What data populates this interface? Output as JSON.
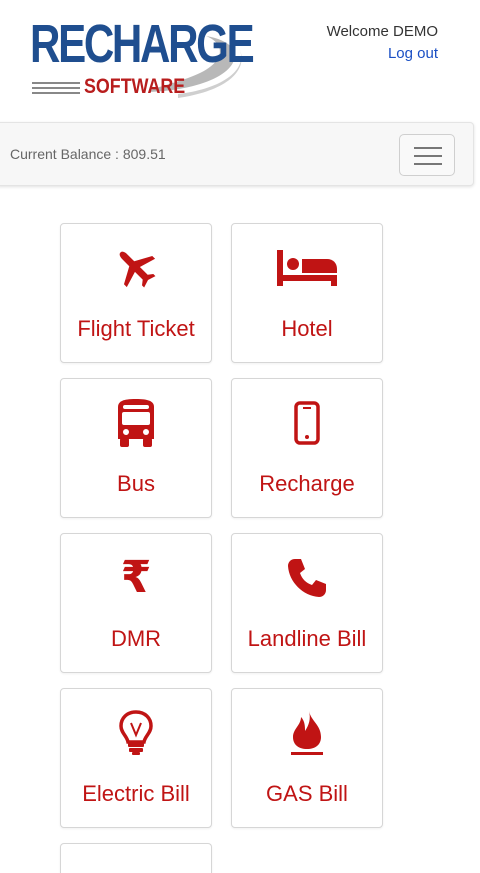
{
  "header": {
    "logo_main": "RECHARGE",
    "logo_sub": "SOFTWARE",
    "welcome_text": "Welcome DEMO",
    "logout_label": "Log out"
  },
  "balance": {
    "text": "Current Balance : 809.51"
  },
  "accent_color": "#c01414",
  "services": [
    {
      "label": "Flight Ticket",
      "icon": "plane-icon"
    },
    {
      "label": "Hotel",
      "icon": "bed-icon"
    },
    {
      "label": "Bus",
      "icon": "bus-icon"
    },
    {
      "label": "Recharge",
      "icon": "mobile-phone-icon"
    },
    {
      "label": "DMR",
      "icon": "rupee-icon",
      "glyph": "₹"
    },
    {
      "label": "Landline Bill",
      "icon": "phone-icon"
    },
    {
      "label": "Electric Bill",
      "icon": "lightbulb-icon"
    },
    {
      "label": "GAS Bill",
      "icon": "gas-flame-icon"
    }
  ]
}
